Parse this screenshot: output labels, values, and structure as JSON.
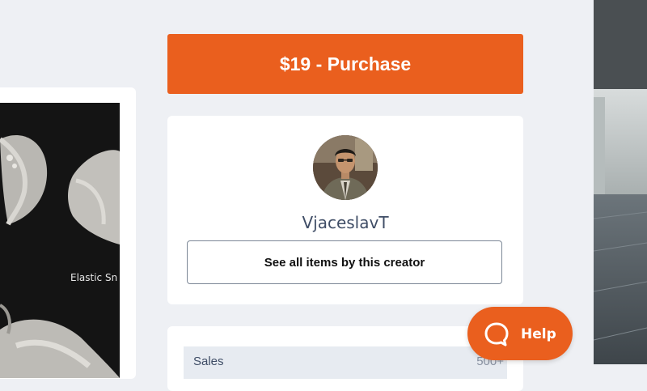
{
  "colors": {
    "accent": "#ea5f1e",
    "page_background": "#eef0f4",
    "card_background": "#ffffff",
    "creator_name_text": "#3f4d66"
  },
  "preview": {
    "caption": "Elastic Sn"
  },
  "purchase": {
    "label": "$19 - Purchase"
  },
  "creator": {
    "avatar_icon": "creator-avatar-photo",
    "name": "VjaceslavT",
    "see_all_label": "See all items by this creator"
  },
  "stats": {
    "rows": [
      {
        "label": "Sales",
        "value": "500+"
      }
    ]
  },
  "help": {
    "icon": "chat-bubble-icon",
    "label": "Help"
  }
}
